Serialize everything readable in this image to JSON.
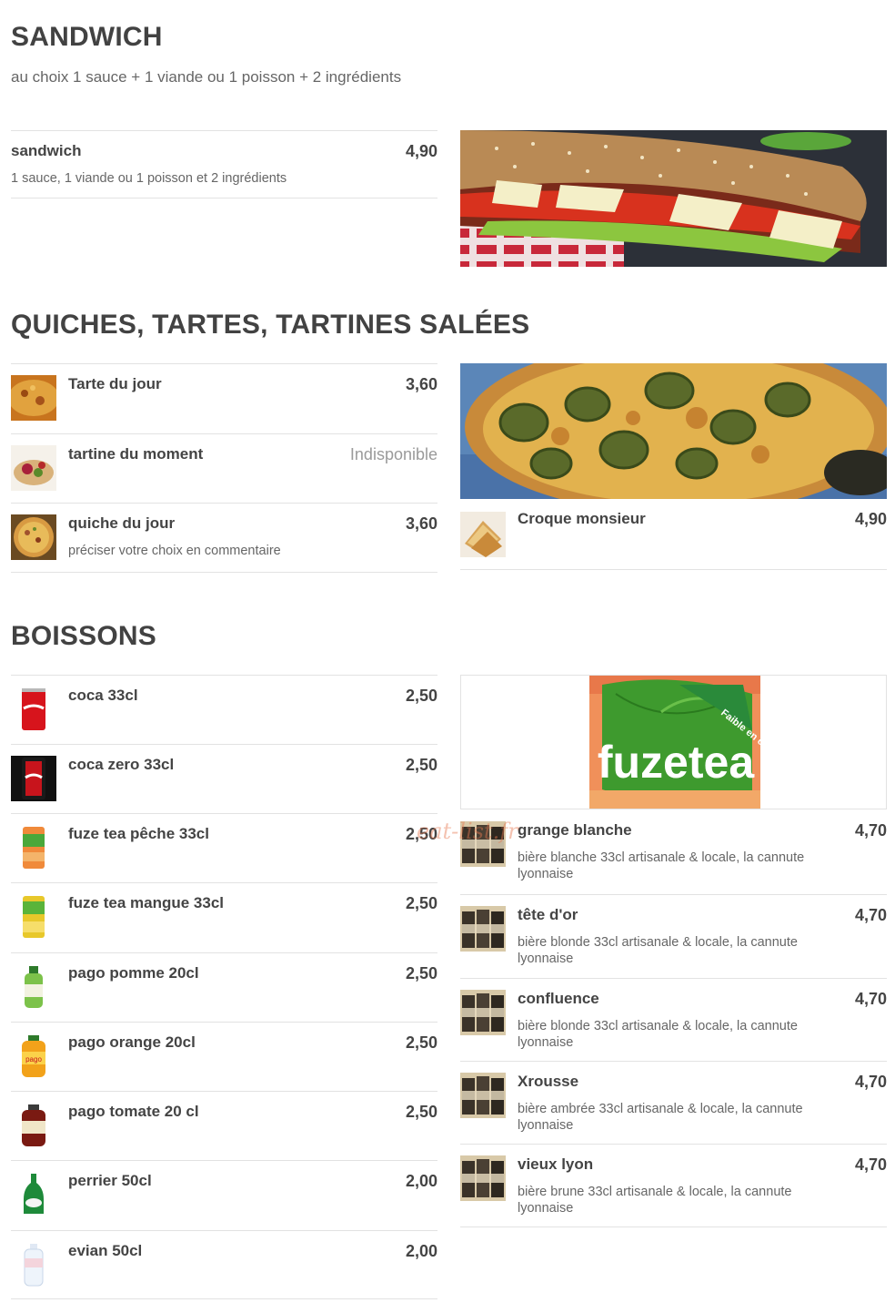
{
  "sandwich": {
    "title": "SANDWICH",
    "subtitle": "au choix 1 sauce + 1 viande ou 1 poisson + 2 ingrédients",
    "items": [
      {
        "name": "sandwich",
        "price": "4,90",
        "desc": "1 sauce, 1 viande ou 1 poisson et 2 ingrédients"
      }
    ]
  },
  "quiches": {
    "title": "QUICHES, TARTES, TARTINES SALÉES",
    "left_items": [
      {
        "name": "Tarte du jour",
        "price": "3,60",
        "icon": "tart-icon"
      },
      {
        "name": "tartine du moment",
        "price": "Indisponible",
        "icon": "tartine-icon"
      },
      {
        "name": "quiche du jour",
        "price": "3,60",
        "desc": "préciser votre choix en commentaire",
        "icon": "quiche-icon"
      }
    ],
    "right_items": [
      {
        "name": "Croque monsieur",
        "price": "4,90",
        "icon": "croque-icon"
      }
    ]
  },
  "boissons": {
    "title": "BOISSONS",
    "left_items": [
      {
        "name": "coca 33cl",
        "price": "2,50",
        "icon": "coca-can-icon"
      },
      {
        "name": "coca zero 33cl",
        "price": "2,50",
        "icon": "coca-zero-can-icon"
      },
      {
        "name": "fuze tea pêche 33cl",
        "price": "2,50",
        "icon": "fuze-tea-peach-can-icon"
      },
      {
        "name": "fuze tea mangue 33cl",
        "price": "2,50",
        "icon": "fuze-tea-mango-can-icon"
      },
      {
        "name": "pago pomme 20cl",
        "price": "2,50",
        "icon": "pago-apple-bottle-icon"
      },
      {
        "name": "pago orange 20cl",
        "price": "2,50",
        "icon": "pago-orange-bottle-icon"
      },
      {
        "name": "pago tomate 20 cl",
        "price": "2,50",
        "icon": "pago-tomato-bottle-icon"
      },
      {
        "name": "perrier 50cl",
        "price": "2,00",
        "icon": "perrier-bottle-icon"
      },
      {
        "name": "evian 50cl",
        "price": "2,00",
        "icon": "evian-bottle-icon"
      }
    ],
    "right_items": [
      {
        "name": "grange blanche",
        "price": "4,70",
        "desc": "bière blanche 33cl artisanale & locale, la cannute lyonnaise",
        "icon": "beer-cans-icon"
      },
      {
        "name": "tête d'or",
        "price": "4,70",
        "desc": "bière blonde 33cl artisanale & locale, la cannute lyonnaise",
        "icon": "beer-cans-icon"
      },
      {
        "name": "confluence",
        "price": "4,70",
        "desc": "bière blonde 33cl artisanale & locale, la cannute lyonnaise",
        "icon": "beer-cans-icon"
      },
      {
        "name": "Xrousse",
        "price": "4,70",
        "desc": "bière ambrée 33cl artisanale & locale, la cannute lyonnaise",
        "icon": "beer-cans-icon"
      },
      {
        "name": "vieux lyon",
        "price": "4,70",
        "desc": "bière brune 33cl artisanale & locale, la cannute lyonnaise",
        "icon": "beer-cans-icon"
      }
    ],
    "fuze_image_text": "fuzetea",
    "fuze_badge_text": "Faible en calories"
  },
  "watermark": "eat-list.fr",
  "colors": {
    "heading": "#424242",
    "text": "#444444",
    "muted": "#666666",
    "unavailable": "#9a9a9a",
    "divider": "#e2e2e2"
  }
}
